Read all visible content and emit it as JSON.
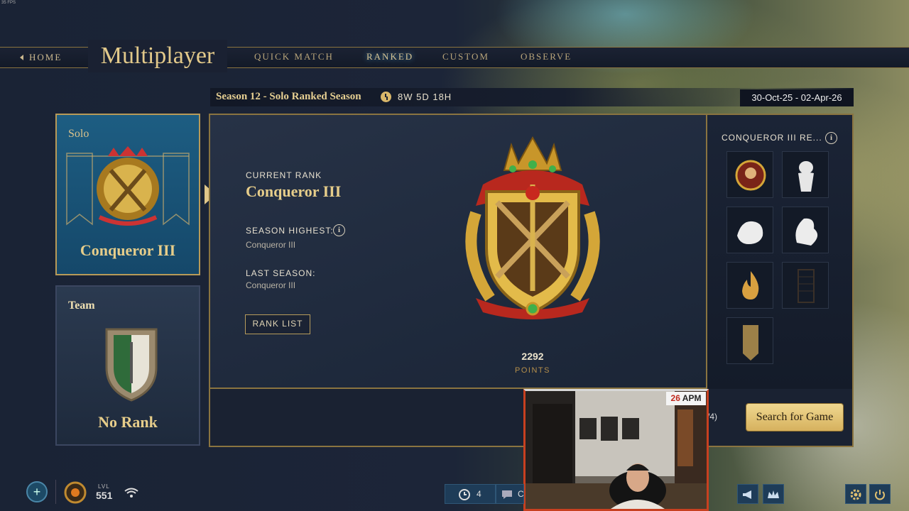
{
  "overlay": {
    "fps": "35 FPS"
  },
  "nav": {
    "home": "HOME",
    "title": "Multiplayer",
    "tabs": [
      {
        "label": "QUICK MATCH",
        "active": false
      },
      {
        "label": "RANKED",
        "active": true
      },
      {
        "label": "CUSTOM",
        "active": false
      },
      {
        "label": "OBSERVE",
        "active": false
      }
    ]
  },
  "season": {
    "name": "Season 12 - Solo Ranked Season",
    "time_left": "8W 5D 18H",
    "dates": "30-Oct-25 - 02-Apr-26"
  },
  "cards": {
    "solo": {
      "label": "Solo",
      "rank": "Conqueror III"
    },
    "team": {
      "label": "Team",
      "rank": "No Rank"
    }
  },
  "current": {
    "current_rank_label": "CURRENT RANK",
    "current_rank": "Conqueror III",
    "season_highest_label": "SEASON HIGHEST:",
    "season_highest": "Conqueror III",
    "last_season_label": "LAST SEASON:",
    "last_season": "Conqueror III",
    "rank_list_button": "RANK LIST",
    "points": "2292",
    "points_label": "POINTS"
  },
  "rewards": {
    "title": "CONQUEROR III RE...",
    "items": [
      "portrait-reward-icon",
      "statue-reward-icon",
      "lion-reward-icon",
      "dragon-reward-icon",
      "flame-reward-icon",
      "pattern-reward-icon",
      "banner-reward-icon"
    ]
  },
  "queue": {
    "count": "/4)",
    "search_button": "Search for Game"
  },
  "webcam": {
    "apm_value": "26",
    "apm_label": "APM"
  },
  "bottom": {
    "level_label": "LVL",
    "level": "551",
    "friends_count": "4",
    "chat_label": "C"
  },
  "colors": {
    "accent_gold": "#e6cd8a",
    "frame_gold": "#8a7440",
    "search_button": "#e8c878"
  }
}
